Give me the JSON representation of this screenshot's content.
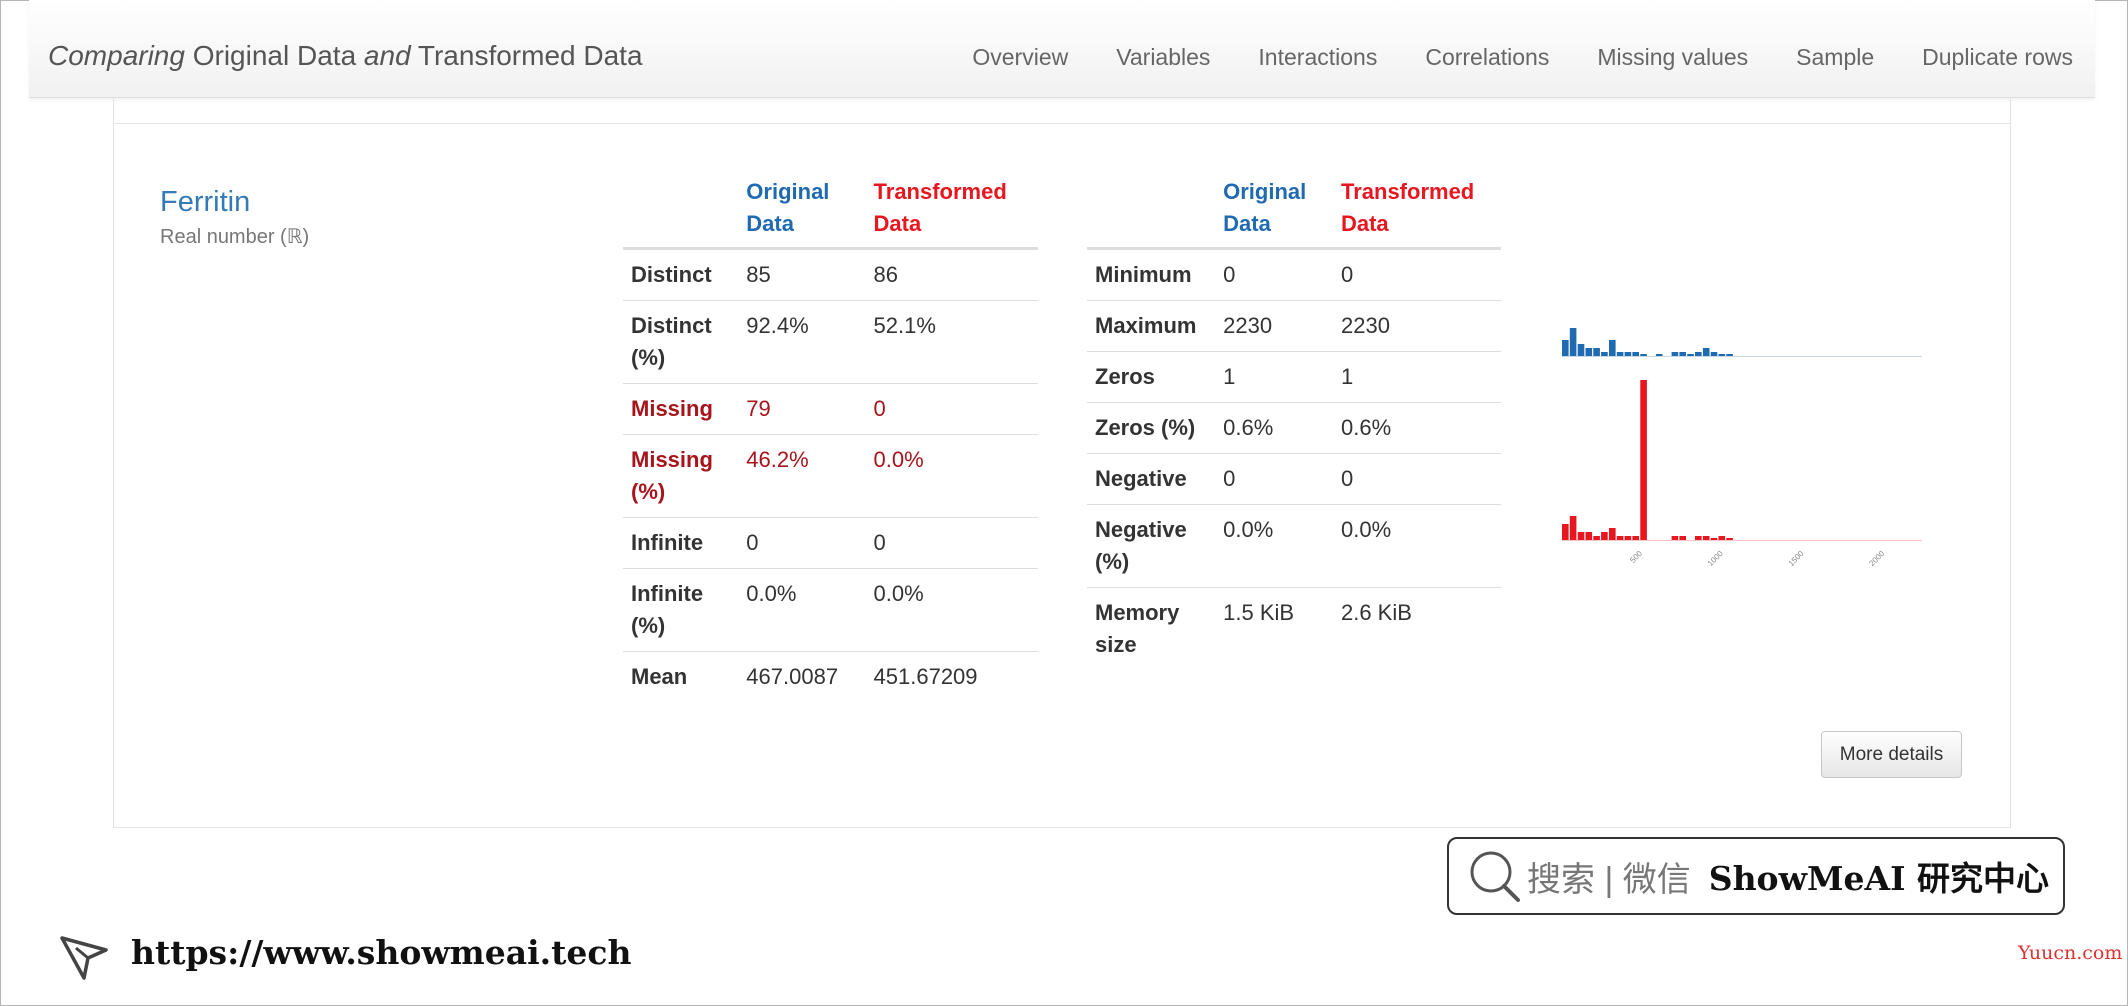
{
  "nav": {
    "title_parts": [
      "Comparing",
      " Original Data ",
      "and",
      " Transformed Data"
    ],
    "items": [
      "Overview",
      "Variables",
      "Interactions",
      "Correlations",
      "Missing values",
      "Sample",
      "Duplicate rows"
    ]
  },
  "variable": {
    "name": "Ferritin",
    "type": "Real number (ℝ)"
  },
  "headers": {
    "original": "Original Data",
    "transformed": "Transformed Data"
  },
  "table1": [
    {
      "label": "Distinct",
      "orig": "85",
      "trans": "86"
    },
    {
      "label": "Distinct (%)",
      "orig": "92.4%",
      "trans": "52.1%"
    },
    {
      "label": "Missing",
      "orig": "79",
      "trans": "0",
      "alert": true
    },
    {
      "label": "Missing (%)",
      "orig": "46.2%",
      "trans": "0.0%",
      "alert": true
    },
    {
      "label": "Infinite",
      "orig": "0",
      "trans": "0"
    },
    {
      "label": "Infinite (%)",
      "orig": "0.0%",
      "trans": "0.0%"
    },
    {
      "label": "Mean",
      "orig": "467.0087",
      "trans": "451.67209"
    }
  ],
  "table2": [
    {
      "label": "Minimum",
      "orig": "0",
      "trans": "0"
    },
    {
      "label": "Maximum",
      "orig": "2230",
      "trans": "2230"
    },
    {
      "label": "Zeros",
      "orig": "1",
      "trans": "1"
    },
    {
      "label": "Zeros (%)",
      "orig": "0.6%",
      "trans": "0.6%"
    },
    {
      "label": "Negative",
      "orig": "0",
      "trans": "0"
    },
    {
      "label": "Negative (%)",
      "orig": "0.0%",
      "trans": "0.0%"
    },
    {
      "label": "Memory size",
      "orig": "1.5 KiB",
      "trans": "2.6 KiB"
    }
  ],
  "chart_data": {
    "type": "bar",
    "x_ticks": [
      "0",
      "500",
      "1000",
      "1500",
      "2000"
    ],
    "xlim": [
      0,
      2230
    ],
    "series": [
      {
        "color": "#1f6ab1",
        "values": [
          4,
          7,
          3,
          2,
          2,
          1,
          4,
          1,
          1,
          1,
          0.5,
          0,
          0.5,
          0,
          1,
          1,
          0.5,
          1,
          2,
          1,
          0.5,
          0.5,
          0,
          0,
          0,
          0,
          0,
          0,
          0,
          0,
          0,
          0,
          0,
          0,
          0,
          0,
          0,
          0,
          0,
          0,
          0,
          0,
          0,
          0,
          0,
          0
        ]
      },
      {
        "color": "#e8161f",
        "values": [
          4,
          6,
          2,
          2,
          1,
          2,
          3,
          1,
          1,
          1,
          40,
          0,
          0,
          0,
          1,
          1,
          0,
          1,
          1,
          0.5,
          1,
          0.5,
          0,
          0,
          0,
          0,
          0,
          0,
          0,
          0,
          0,
          0,
          0,
          0,
          0,
          0,
          0,
          0,
          0,
          0,
          0,
          0,
          0,
          0,
          0,
          0
        ]
      }
    ]
  },
  "more_details": "More details",
  "watermark": {
    "search_text": "搜索 | 微信",
    "brand": "ShowMeAI 研究中心"
  },
  "footer": {
    "url": "https://www.showmeai.tech",
    "credit": "Yuucn.com"
  },
  "colors": {
    "original": "#1f6ab1",
    "transformed": "#e8161f",
    "alert": "#a8141b",
    "link": "#337ab7"
  }
}
